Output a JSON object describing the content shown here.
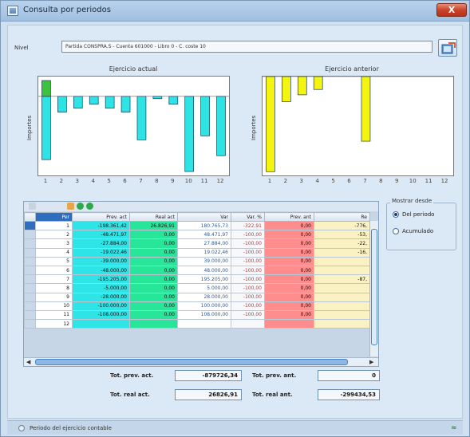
{
  "window": {
    "title": "Consulta por periodos",
    "close_label": "X"
  },
  "nivel": {
    "label": "Nivel",
    "value": "Partida CONSPRA.S - Cuenta 601000 - Libro 0 - C. coste 10"
  },
  "icons": {
    "export": "export-chart-icon",
    "close": "close-icon"
  },
  "chart_data": [
    {
      "type": "bar",
      "title": "Ejercicio actual",
      "ylabel": "Importes",
      "categories": [
        "1",
        "2",
        "3",
        "4",
        "5",
        "6",
        "7",
        "8",
        "9",
        "10",
        "11",
        "12"
      ],
      "series": [
        {
          "values": [
            -80000,
            -20000,
            -15000,
            -10000,
            -15000,
            -20000,
            -55000,
            -3000,
            -10000,
            -95000,
            -50000,
            -75000
          ],
          "color": "#2ee3e3"
        },
        {
          "values": [
            20000,
            0,
            0,
            0,
            0,
            0,
            0,
            0,
            0,
            0,
            0,
            0
          ],
          "color": "#3cc23c"
        }
      ],
      "ylim": [
        -100000,
        25000
      ]
    },
    {
      "type": "bar",
      "title": "Ejercicio anterior",
      "ylabel": "Importes",
      "categories": [
        "1",
        "2",
        "3",
        "4",
        "5",
        "6",
        "7",
        "8",
        "9",
        "10",
        "11",
        "12"
      ],
      "series": [
        {
          "values": [
            -125000,
            -33000,
            -24000,
            -17000,
            0,
            0,
            -85000,
            0,
            0,
            0,
            0,
            0
          ],
          "color": "#f4f411"
        }
      ],
      "ylim": [
        -130000,
        0
      ]
    }
  ],
  "grid": {
    "columns": [
      "Per",
      "Prev. act",
      "Real act",
      "Var",
      "Var. %",
      "Prev. ant",
      "Re"
    ],
    "rows": [
      [
        "1",
        "-198.361,42",
        "26.826,91",
        "180.765,73",
        "-322,91",
        "0,00",
        "-776,"
      ],
      [
        "2",
        "-48.471,97",
        "0,00",
        "48.471,97",
        "-100,00",
        "0,00",
        "-53,"
      ],
      [
        "3",
        "-27.884,00",
        "0,00",
        "27.884,00",
        "-100,00",
        "0,00",
        "-22,"
      ],
      [
        "4",
        "-19.022,46",
        "0,00",
        "19.022,46",
        "-100,00",
        "0,00",
        "-16,"
      ],
      [
        "5",
        "-39.000,00",
        "0,00",
        "39.000,00",
        "-100,00",
        "0,00",
        ""
      ],
      [
        "6",
        "-48.000,00",
        "0,00",
        "48.000,00",
        "-100,00",
        "0,00",
        ""
      ],
      [
        "7",
        "-195.205,00",
        "0,00",
        "195.205,00",
        "-100,00",
        "0,00",
        "-87,"
      ],
      [
        "8",
        "-5.000,00",
        "0,00",
        "5.000,00",
        "-100,00",
        "0,00",
        ""
      ],
      [
        "9",
        "-28.000,00",
        "0,00",
        "28.000,00",
        "-100,00",
        "0,00",
        ""
      ],
      [
        "10",
        "-100.000,00",
        "0,00",
        "100.000,00",
        "-100,00",
        "0,00",
        ""
      ],
      [
        "11",
        "-108.000,00",
        "0,00",
        "108.000,00",
        "-100,00",
        "0,00",
        ""
      ],
      [
        "12",
        "",
        "",
        "",
        "",
        "",
        ""
      ]
    ]
  },
  "totals": {
    "prev_act_label": "Tot. prev. act.",
    "prev_act_value": "-879726,34",
    "real_act_label": "Tot. real act.",
    "real_act_value": "26826,91",
    "prev_ant_label": "Tot. prev. ant.",
    "prev_ant_value": "0",
    "real_ant_label": "Tot. real ant.",
    "real_ant_value": "-299434,53"
  },
  "mostrar": {
    "title": "Mostrar desde",
    "options": [
      "Del periodo",
      "Acumulado"
    ],
    "selected": "Del periodo"
  },
  "status": {
    "text": "Periodo del ejercicio contable",
    "grip": "≈"
  }
}
